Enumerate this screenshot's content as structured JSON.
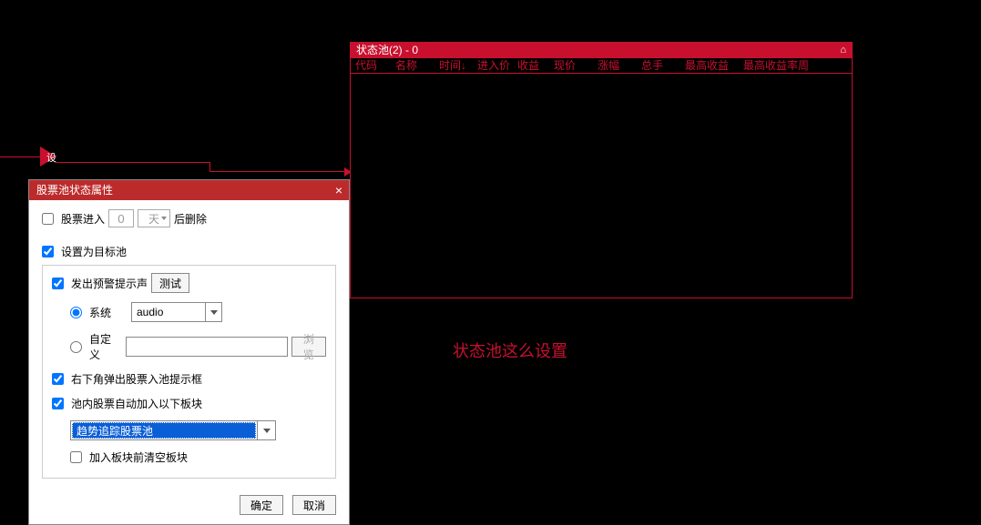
{
  "arrow": {
    "label": "设"
  },
  "state_panel": {
    "title": "状态池(2) - 0",
    "columns": [
      "代码",
      "名称",
      "时间↓",
      "进入价",
      "收益",
      "现价",
      "涨幅",
      "总手",
      "最高收益",
      "最高收益率周"
    ]
  },
  "annotation": "状态池这么设置",
  "dialog": {
    "title": "股票池状态属性",
    "row_delete": {
      "checkbox_label": "股票进入",
      "num_value": "0",
      "unit": "天",
      "after_label": "后删除"
    },
    "target_pool_label": "设置为目标池",
    "alert": {
      "sound_label": "发出预警提示声",
      "test_button": "测试",
      "system_label": "系统",
      "audio_value": "audio",
      "custom_label": "自定义",
      "browse_button": "浏览"
    },
    "popup_label": "右下角弹出股票入池提示框",
    "auto_add_label": "池内股票自动加入以下板块",
    "plate_value": "趋势追踪股票池",
    "clear_plate_label": "加入板块前清空板块",
    "ok_button": "确定",
    "cancel_button": "取消"
  }
}
